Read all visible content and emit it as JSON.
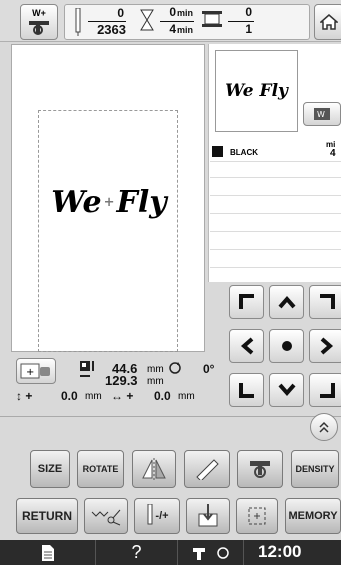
{
  "top_bar": {
    "w_plus_label": "W+",
    "stitch_done": "0",
    "stitch_total": "2363",
    "time_done": "0",
    "time_unit": "min",
    "time_total": "4",
    "color_done": "0",
    "color_total": "1"
  },
  "preview": {
    "design_text_left": "We",
    "design_text_right": "Fly",
    "small_text": "We Fly",
    "thread_color_name": "BLACK",
    "thread_time_unit": "mi",
    "thread_time_value": "4"
  },
  "info": {
    "width_value": "44.6",
    "width_unit": "mm",
    "height_value": "129.3",
    "height_unit": "mm",
    "angle": "0°",
    "vertical_offset": "0.0",
    "vertical_unit": "mm",
    "horizontal_offset": "0.0",
    "horizontal_unit": "mm"
  },
  "edit_row": {
    "size_label": "SIZE",
    "rotate_label": "ROTATE",
    "density_label": "DENSITY"
  },
  "bottom_row": {
    "return_label": "RETURN",
    "stitch_label": "-/+",
    "memory_label": "MEMORY"
  },
  "status_bar": {
    "help_label": "?",
    "clock": "12:00"
  }
}
